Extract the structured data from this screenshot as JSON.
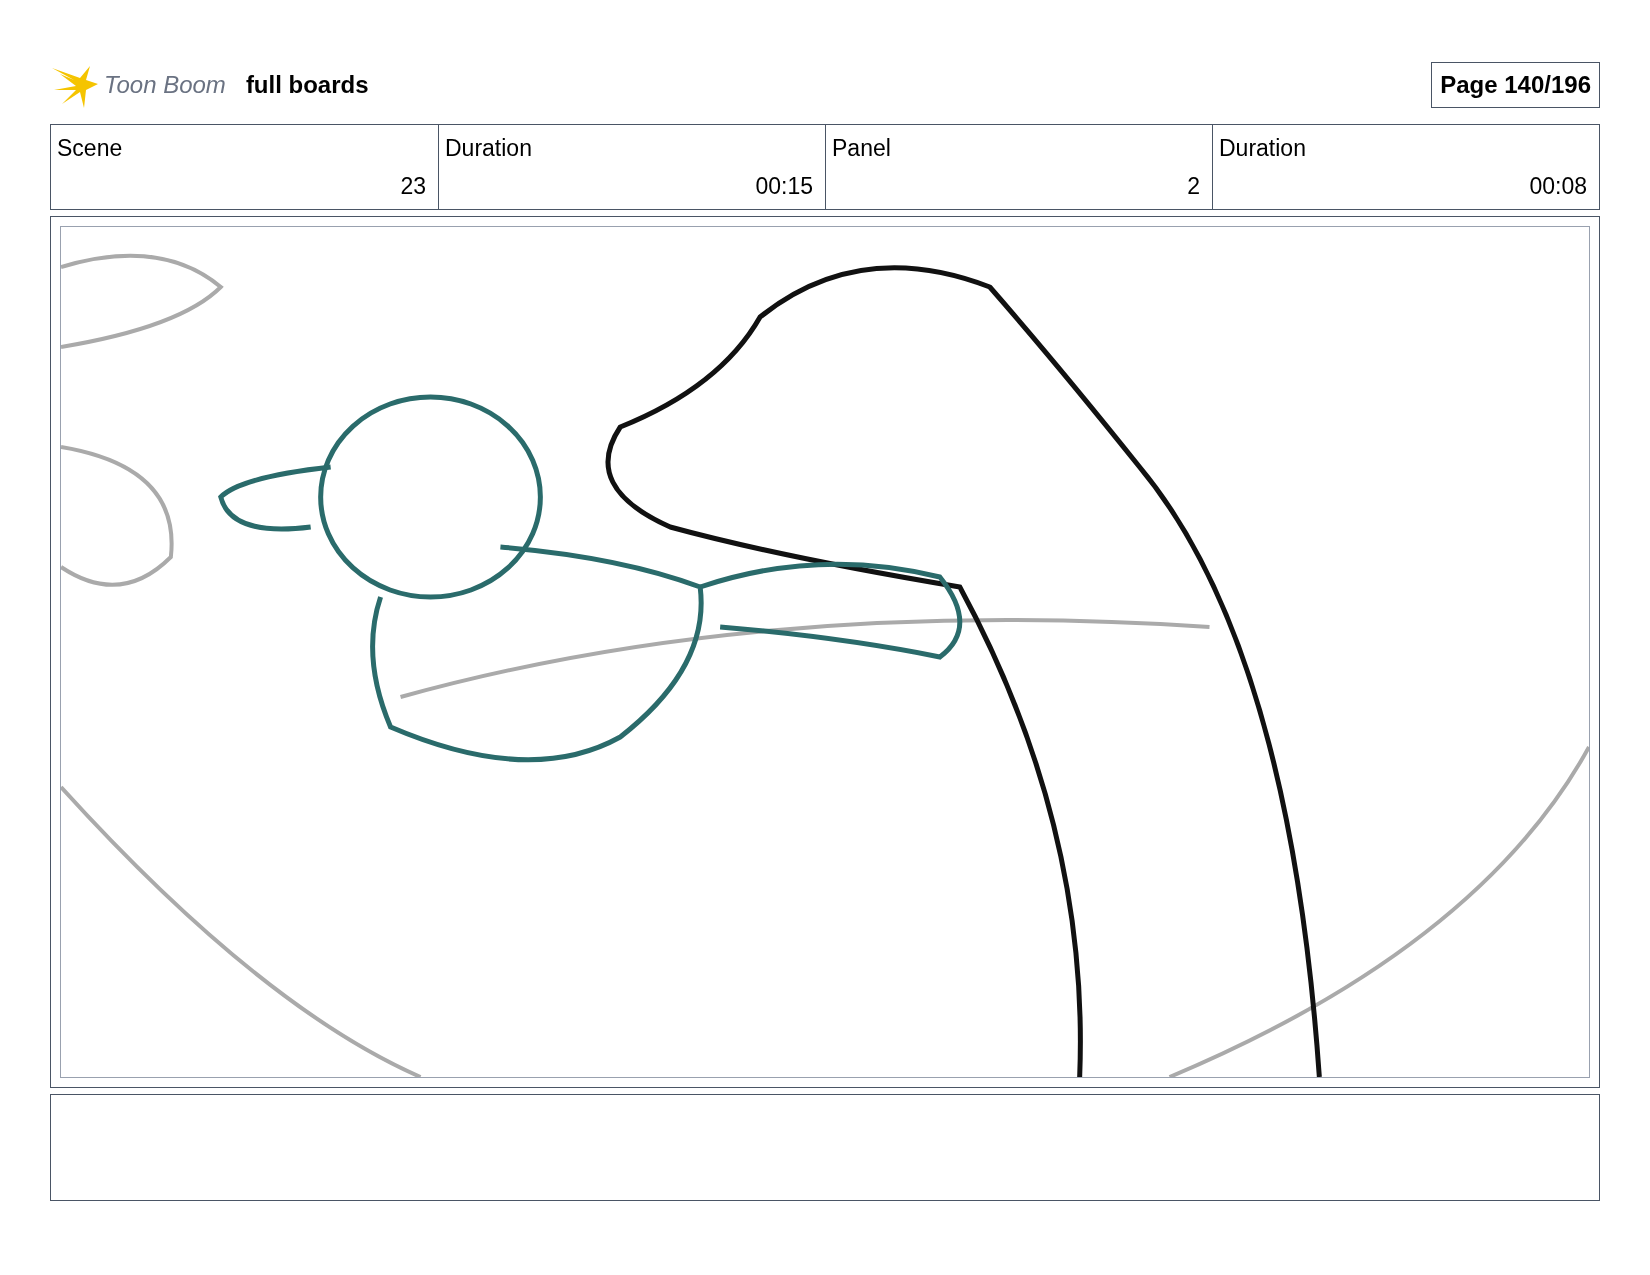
{
  "header": {
    "logo_text": "Toon Boom",
    "project": "full boards",
    "page": "Page 140/196"
  },
  "info_table": {
    "columns": [
      "Scene",
      "Duration",
      "Panel",
      "Duration"
    ],
    "values": [
      "23",
      "00:15",
      "2",
      "00:08"
    ]
  }
}
